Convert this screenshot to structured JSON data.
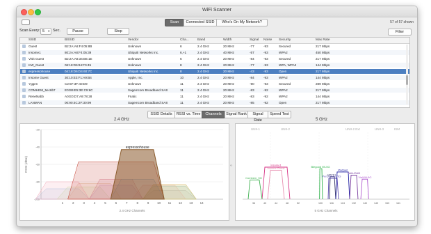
{
  "window": {
    "title": "WiFi Scanner",
    "shown_count": "57 of 57 shown"
  },
  "mode_tabs": [
    "Scan",
    "Connected SSID",
    "Who's On My Network?"
  ],
  "controls": {
    "scan_every_label": "Scan Every:",
    "scan_every_value": "5",
    "sec_label": "Sec.",
    "pause": "Pause",
    "stop": "Stop",
    "filter": "Filter"
  },
  "table": {
    "columns": [
      "SSID",
      "BSSID",
      "Vendor",
      "Cha...",
      "Band",
      "Width",
      "Signal",
      "Noise",
      "Security",
      "Max Rate"
    ],
    "rows": [
      [
        "Guest",
        "B2:2A:A6:F4:05:8B",
        "Unknown",
        "6",
        "2.4 GHz",
        "20 MHz",
        "-77",
        "-93",
        "Secured",
        "217 Mbps"
      ],
      [
        "Insome1",
        "80:2A:A8:F4:05:39",
        "Ubiquiti Networks Inc.",
        "6,+1",
        "2.4 GHz",
        "40 MHz",
        "-57",
        "-93",
        "WPA2",
        "450 Mbps"
      ],
      [
        "Visit Guest",
        "B2:2A:A8:34:B6:1E",
        "Unknown",
        "6",
        "2.4 GHz",
        "20 MHz",
        "-84",
        "-93",
        "Secured",
        "217 Mbps"
      ],
      [
        "KW_Guest",
        "06:18:D6:94:F0:45",
        "Unknown",
        "8",
        "2.4 GHz",
        "20 MHz",
        "-77",
        "-93",
        "WPA, WPA2",
        "144 Mbps"
      ],
      [
        "espressohouse",
        "04:18:D6:D4:60:7C",
        "Ubiquiti Networks Inc.",
        "8",
        "2.4 GHz",
        "20 MHz",
        "-43",
        "-93",
        "Open",
        "217 Mbps"
      ],
      [
        "Insome Guest",
        "30:10:E3:F1:A9:B4",
        "Apple, Inc.",
        "10",
        "2.4 GHz",
        "20 MHz",
        "-84",
        "-93",
        "WPA2",
        "144 Mbps"
      ],
      [
        "Yggen",
        "C2:5F:3F:40:D9",
        "Unknown",
        "11",
        "2.4 GHz",
        "20 MHz",
        "-90",
        "-93",
        "Secured",
        "289 Mbps"
      ],
      [
        "COMHEM_5ec6b7",
        "E0:B9:E5:3E:C9:6C",
        "Sagemcom Broadband SAS",
        "11",
        "2.4 GHz",
        "20 MHz",
        "-83",
        "-92",
        "WPA2",
        "217 Mbps"
      ],
      [
        "ReneNabb",
        "A0:E0:D7:A9:78:28",
        "Fnatic",
        "11",
        "2.4 GHz",
        "20 MHz",
        "-83",
        "-92",
        "WPA2",
        "144 Mbps"
      ],
      [
        "LANMAN",
        "00:90:4C:2F:30:99",
        "Sagemcom Broadband SAS",
        "11",
        "2.4 GHz",
        "20 MHz",
        "-85",
        "-92",
        "Open",
        "217 Mbps"
      ]
    ]
  },
  "view_tabs": [
    "SSID Details",
    "RSSI vs. Time",
    "Channels",
    "Signal Rank",
    "Signal Rate",
    "Speed Test"
  ],
  "charts": {
    "left": {
      "title": "2.4 GHz",
      "ylabel": "RSSI (dBm)",
      "xlabel": "2.4 GHz Channels",
      "highlight": "espressohouse"
    },
    "right": {
      "title": "5 GHz",
      "xlabel": "5 GHz Channels",
      "unii": [
        "UNII-1",
        "UNII-2",
        "UNII-2 Ext",
        "UNII-3",
        "ISM"
      ],
      "net_labels": [
        "Insome1",
        "Insome Guest",
        "Blegood Wi-5G",
        "UPTT1",
        "PerUnitMS_5G",
        "ViaQuel",
        "TalkUSAB",
        "ViaWifi-5G",
        "Comhem_5G"
      ]
    }
  },
  "chart_data": [
    {
      "type": "area",
      "title": "2.4 GHz",
      "xlabel": "2.4 GHz Channels",
      "ylabel": "RSSI (dBm)",
      "x_ticks": [
        1,
        2,
        3,
        4,
        5,
        6,
        7,
        8,
        9,
        10,
        11,
        12,
        13,
        14
      ],
      "y_ticks": [
        -20,
        -40,
        -60,
        -80,
        -100
      ],
      "ylim": [
        -100,
        -20
      ],
      "series": [
        {
          "name": "espressohouse",
          "channel": 8,
          "width_mhz": 20,
          "rssi": -43,
          "color": "#8a5a2b"
        },
        {
          "name": "Insome1",
          "channel": 6,
          "width_mhz": 40,
          "rssi": -57,
          "color": "#c0392b"
        },
        {
          "name": "Guest",
          "channel": 6,
          "width_mhz": 20,
          "rssi": -77,
          "color": "#d98fa0"
        },
        {
          "name": "KW_Guest",
          "channel": 8,
          "width_mhz": 20,
          "rssi": -77,
          "color": "#7fb7e0"
        },
        {
          "name": "COMHEM_5ec6b7",
          "channel": 11,
          "width_mhz": 20,
          "rssi": -83,
          "color": "#a5d38f"
        },
        {
          "name": "ReneNabb",
          "channel": 11,
          "width_mhz": 20,
          "rssi": -83,
          "color": "#e8c27a"
        },
        {
          "name": "Visit Guest",
          "channel": 6,
          "width_mhz": 20,
          "rssi": -84,
          "color": "#c7a2e0"
        },
        {
          "name": "Insome Guest",
          "channel": 10,
          "width_mhz": 20,
          "rssi": -84,
          "color": "#f0b0b0"
        },
        {
          "name": "LANMAN",
          "channel": 11,
          "width_mhz": 20,
          "rssi": -85,
          "color": "#9fc9c9"
        },
        {
          "name": "Yggen",
          "channel": 11,
          "width_mhz": 20,
          "rssi": -90,
          "color": "#bbbbbb"
        },
        {
          "channel": 1,
          "width_mhz": 20,
          "rssi": -80,
          "color": "#f2a7b8"
        },
        {
          "channel": 1,
          "width_mhz": 20,
          "rssi": -88,
          "color": "#a8c8e8"
        },
        {
          "channel": 3,
          "width_mhz": 20,
          "rssi": -86,
          "color": "#c6e2a8"
        },
        {
          "channel": 4,
          "width_mhz": 20,
          "rssi": -82,
          "color": "#e2c6a8"
        }
      ]
    },
    {
      "type": "area",
      "title": "5 GHz",
      "xlabel": "5 GHz Channels",
      "x_ticks": [
        36,
        40,
        44,
        48,
        52,
        100,
        116,
        124,
        132,
        140,
        149,
        153,
        161
      ],
      "bands": [
        "UNII-1",
        "UNII-2",
        "UNII-2 Ext",
        "UNII-3",
        "ISM"
      ],
      "series": [
        {
          "name": "Insome1",
          "channel": 44,
          "width_mhz": 40,
          "rssi": -60,
          "color": "#d63384"
        },
        {
          "name": "Insome Guest",
          "channel": 44,
          "width_mhz": 20,
          "rssi": -64,
          "color": "#e88fb0"
        },
        {
          "name": "Blegood Wi-5G",
          "channel": 100,
          "width_mhz": 20,
          "rssi": -62,
          "color": "#2fb24a"
        },
        {
          "name": "UPTT1",
          "channel": 116,
          "width_mhz": 20,
          "rssi": -72,
          "color": "#333366"
        },
        {
          "name": "PerUnitMS_5G",
          "channel": 116,
          "width_mhz": 40,
          "rssi": -74,
          "color": "#5a4ab0"
        },
        {
          "name": "ViaQuel",
          "channel": 124,
          "width_mhz": 40,
          "rssi": -66,
          "color": "#1a1aa0"
        },
        {
          "name": "TalkUSAB",
          "channel": 132,
          "width_mhz": 20,
          "rssi": -70,
          "color": "#7b3fa0"
        },
        {
          "name": "ViaWifi-5G",
          "channel": 140,
          "width_mhz": 20,
          "rssi": -75,
          "color": "#b05ad0"
        },
        {
          "name": "Comhem_5G",
          "channel": 36,
          "width_mhz": 20,
          "rssi": -76,
          "color": "#3fb050"
        }
      ]
    }
  ]
}
